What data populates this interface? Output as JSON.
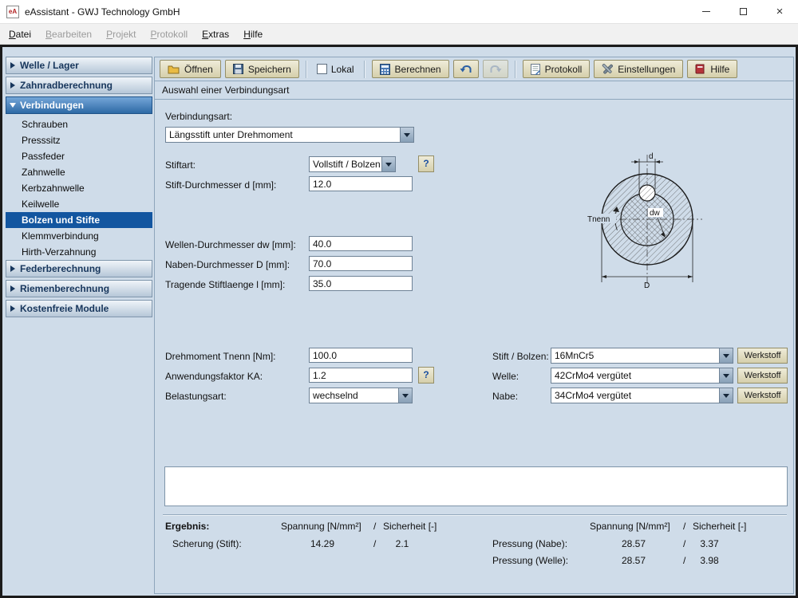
{
  "window": {
    "title": "eAssistant - GWJ Technology GmbH",
    "icon_text": "eA"
  },
  "menubar": {
    "datei": "Datei",
    "bearbeiten": "Bearbeiten",
    "projekt": "Projekt",
    "protokoll": "Protokoll",
    "extras": "Extras",
    "hilfe": "Hilfe"
  },
  "sidebar": {
    "welle_lager": "Welle / Lager",
    "zahnradberechnung": "Zahnradberechnung",
    "verbindungen": "Verbindungen",
    "verbindungen_items": [
      "Schrauben",
      "Presssitz",
      "Passfeder",
      "Zahnwelle",
      "Kerbzahnwelle",
      "Keilwelle",
      "Bolzen und Stifte",
      "Klemmverbindung",
      "Hirth-Verzahnung"
    ],
    "federberechnung": "Federberechnung",
    "riemenberechnung": "Riemenberechnung",
    "kostenfreie_module": "Kostenfreie Module"
  },
  "toolbar": {
    "oeffnen": "Öffnen",
    "speichern": "Speichern",
    "lokal": "Lokal",
    "berechnen": "Berechnen",
    "protokoll": "Protokoll",
    "einstellungen": "Einstellungen",
    "hilfe": "Hilfe"
  },
  "subheader": "Auswahl einer Verbindungsart",
  "form": {
    "verbindungsart": {
      "label": "Verbindungsart:",
      "value": "Längsstift unter Drehmoment"
    },
    "stiftart": {
      "label": "Stiftart:",
      "value": "Vollstift / Bolzen",
      "help": "?"
    },
    "stift_durchmesser": {
      "label": "Stift-Durchmesser d [mm]:",
      "value": "12.0"
    },
    "wellen_durchmesser": {
      "label": "Wellen-Durchmesser dw [mm]:",
      "value": "40.0"
    },
    "naben_durchmesser": {
      "label": "Naben-Durchmesser D [mm]:",
      "value": "70.0"
    },
    "stiftlaenge": {
      "label": "Tragende Stiftlaenge l [mm]:",
      "value": "35.0"
    },
    "drehmoment": {
      "label": "Drehmoment Tnenn [Nm]:",
      "value": "100.0"
    },
    "anwendungsfaktor": {
      "label": "Anwendungsfaktor KA:",
      "value": "1.2",
      "help": "?"
    },
    "belastungsart": {
      "label": "Belastungsart:",
      "value": "wechselnd"
    }
  },
  "materials": {
    "werkstoff_button": "Werkstoff",
    "stift": {
      "label": "Stift / Bolzen:",
      "value": "16MnCr5"
    },
    "welle": {
      "label": "Welle:",
      "value": "42CrMo4 vergütet"
    },
    "nabe": {
      "label": "Nabe:",
      "value": "34CrMo4 vergütet"
    }
  },
  "diagram": {
    "labels": {
      "d": "d",
      "dw": "dw",
      "D": "D",
      "tnenn": "Tnenn"
    }
  },
  "results": {
    "title": "Ergebnis:",
    "col_spannung": "Spannung [N/mm²]",
    "col_slash": "/",
    "col_sicherheit": "Sicherheit [-]",
    "scherung": {
      "label": "Scherung (Stift):",
      "spannung": "14.29",
      "sicherheit": "2.1"
    },
    "pressung_nabe": {
      "label": "Pressung (Nabe):",
      "spannung": "28.57",
      "sicherheit": "3.37"
    },
    "pressung_welle": {
      "label": "Pressung (Welle):",
      "spannung": "28.57",
      "sicherheit": "3.98"
    }
  }
}
